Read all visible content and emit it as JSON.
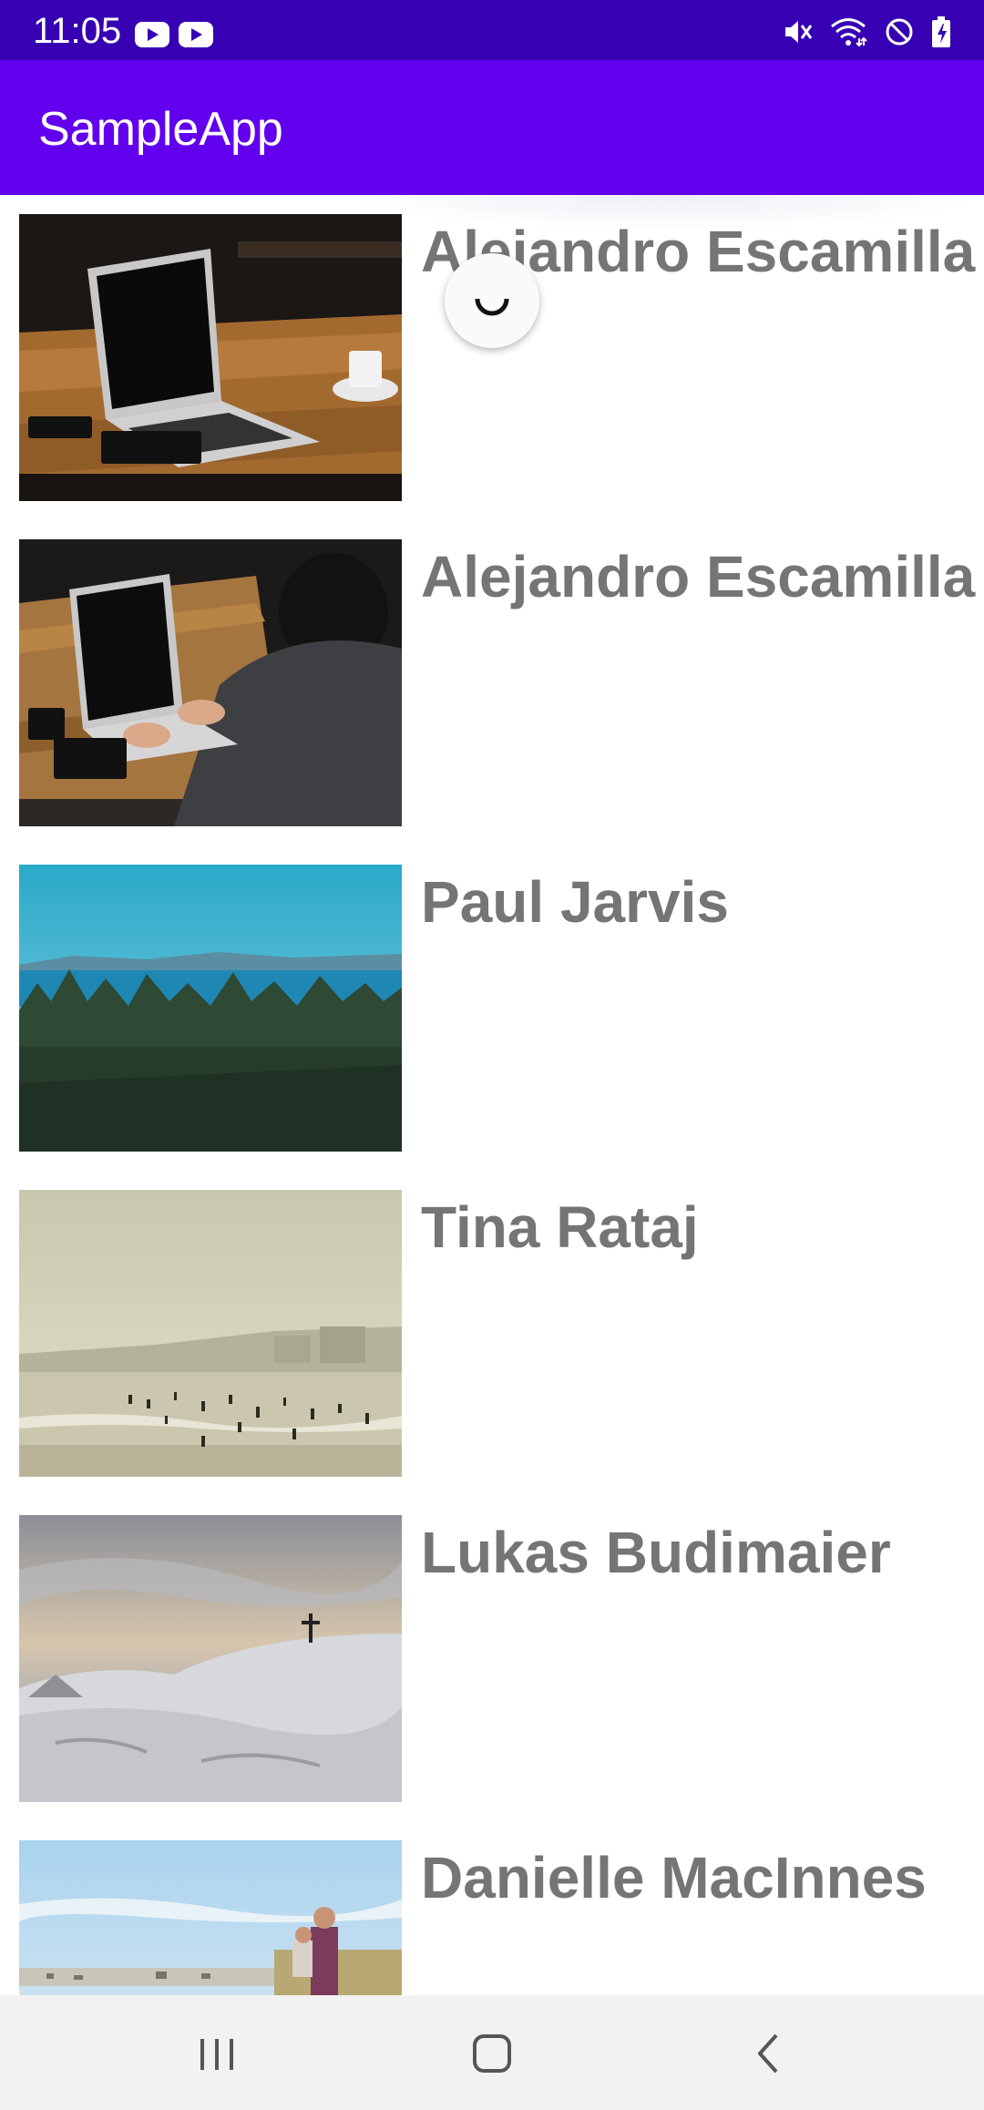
{
  "status_bar": {
    "time": "11:05",
    "left_icons": [
      "youtube-icon",
      "youtube-icon"
    ],
    "right_icons": [
      "mute-icon",
      "wifi-icon",
      "do-not-disturb-icon",
      "battery-charging-icon"
    ]
  },
  "app_bar": {
    "title": "SampleApp"
  },
  "list": {
    "items": [
      {
        "name": "Alejandro Escamilla",
        "image": "laptop-on-table"
      },
      {
        "name": "Alejandro Escamilla",
        "image": "person-typing-laptop"
      },
      {
        "name": "Paul Jarvis",
        "image": "forest-and-sea"
      },
      {
        "name": "Tina Rataj",
        "image": "hazy-beach"
      },
      {
        "name": "Lukas Budimaier",
        "image": "snowy-hill-cross"
      },
      {
        "name": "Danielle MacInnes",
        "image": "father-and-child-field"
      }
    ]
  },
  "refresh": {
    "state": "loading"
  },
  "nav_bar": {
    "buttons": [
      "recent-apps-icon",
      "home-icon",
      "back-icon"
    ]
  },
  "colors": {
    "status_bar": "#3700B3",
    "app_bar": "#6200EE",
    "item_text": "#757575",
    "nav_bar": "#f2f2f2"
  }
}
